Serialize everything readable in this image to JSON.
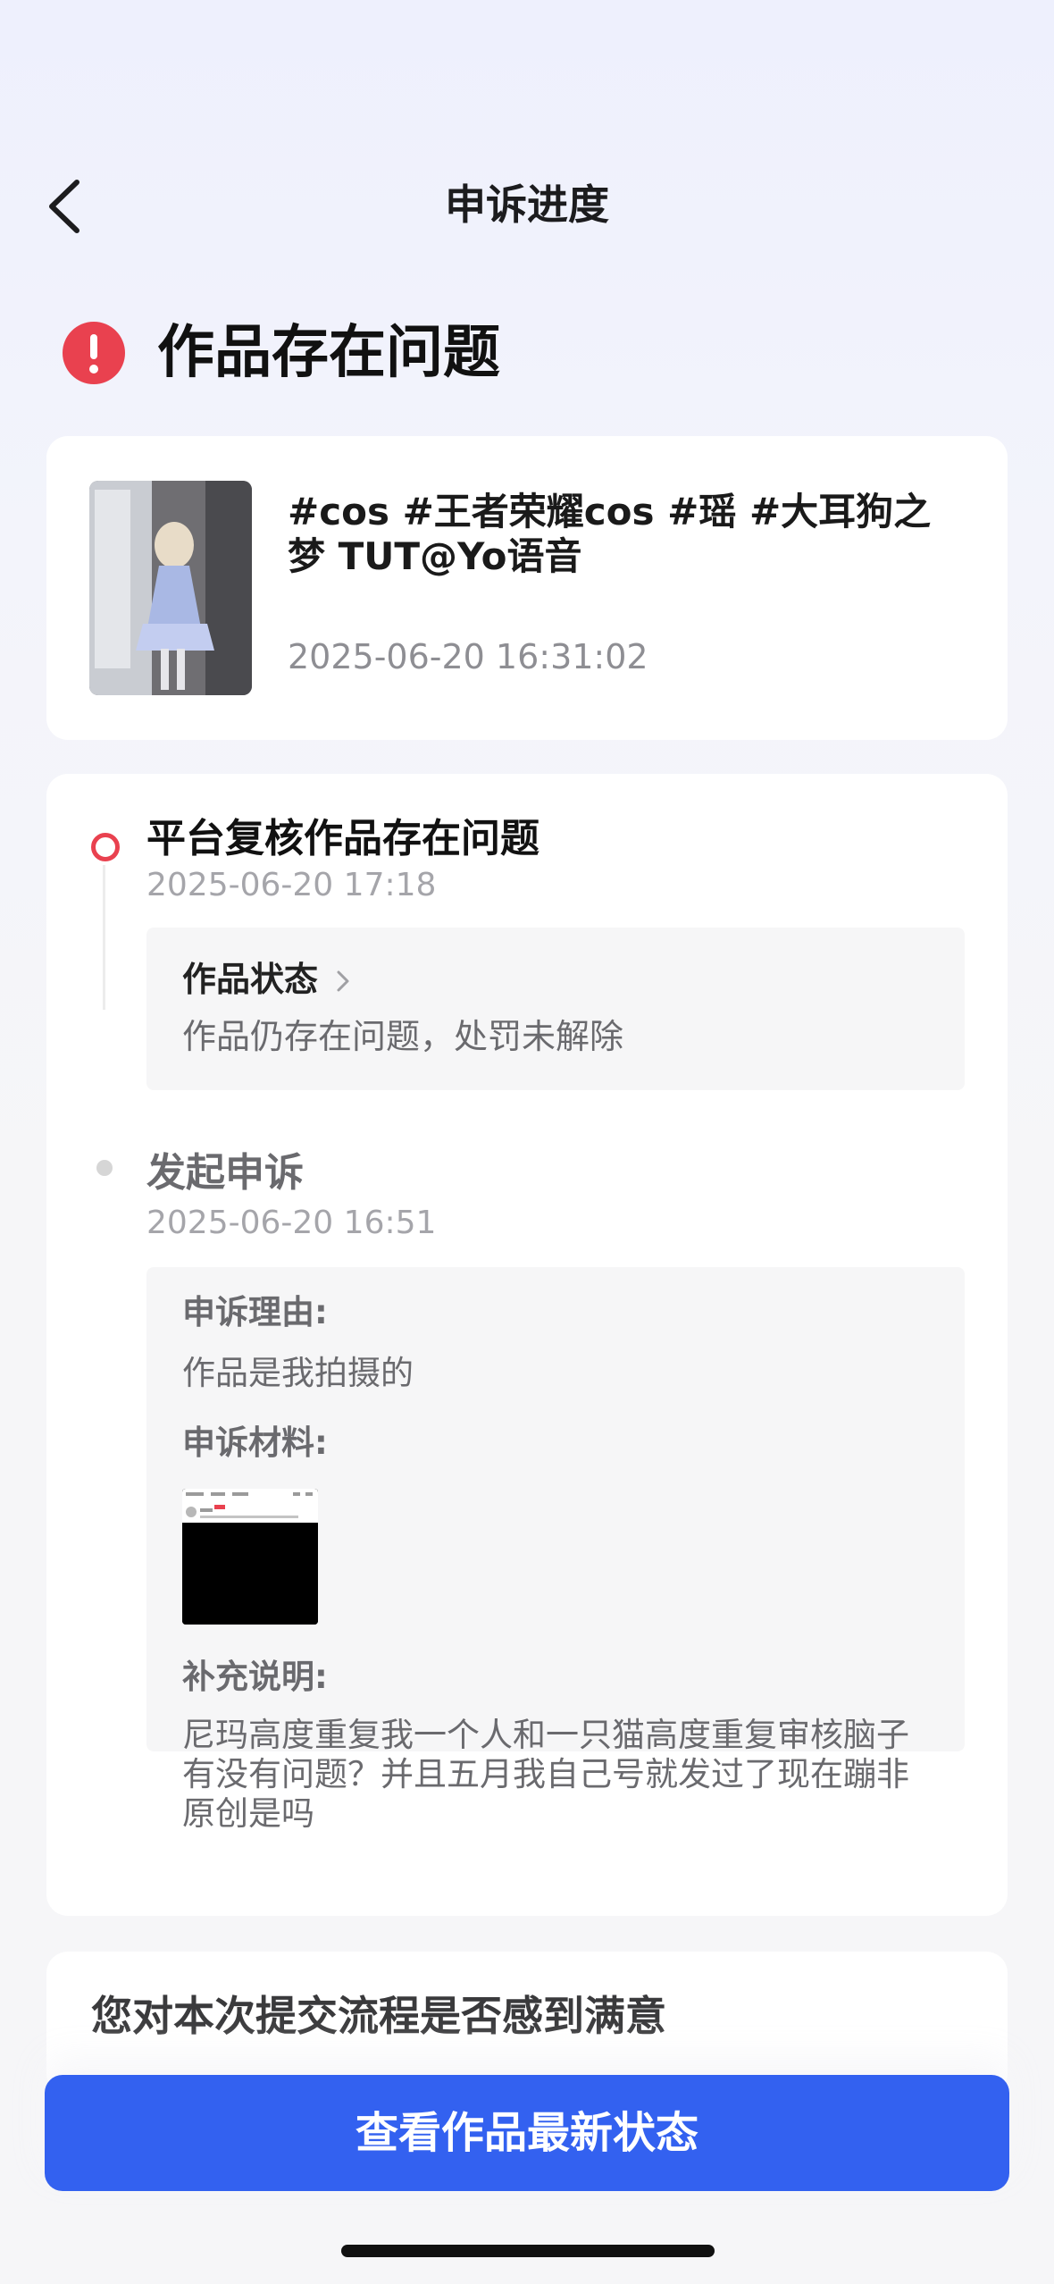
{
  "header": {
    "title": "申诉进度",
    "back_icon": "chevron-left-icon"
  },
  "status": {
    "icon": "alert-circle-icon",
    "text": "作品存在问题",
    "color": "#e9414f"
  },
  "work": {
    "title": "#cos #王者荣耀cos #瑶 #大耳狗之梦 TUT@Yo语音",
    "time": "2025-06-20 16:31:02"
  },
  "timeline": {
    "step1": {
      "title": "平台复核作品存在问题",
      "time": "2025-06-20 17:18",
      "box_label": "作品状态",
      "box_text": "作品仍存在问题，处罚未解除"
    },
    "step2": {
      "title": "发起申诉",
      "time": "2025-06-20 16:51",
      "reason_label": "申诉理由:",
      "reason_text": "作品是我拍摄的",
      "material_label": "申诉材料:",
      "note_label": "补充说明:",
      "note_text": "尼玛高度重复我一个人和一只猫高度重复审核脑子有没有问题？并且五月我自己号就发过了现在蹦非原创是吗"
    }
  },
  "survey": {
    "question": "您对本次提交流程是否感到满意"
  },
  "cta": {
    "label": "查看作品最新状态",
    "color": "#3361f0"
  }
}
